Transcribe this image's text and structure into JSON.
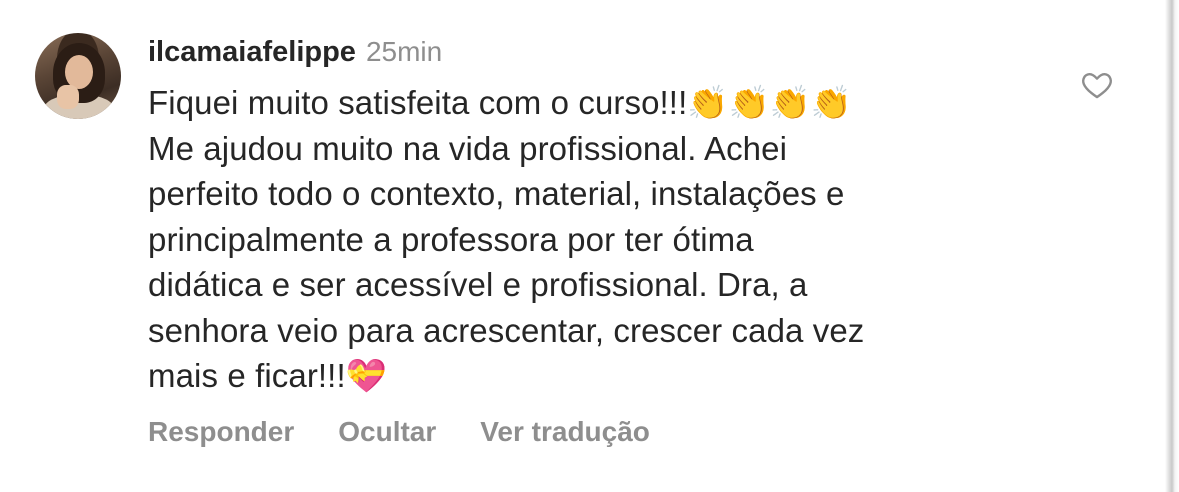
{
  "comment": {
    "username": "ilcamaiafelippe",
    "timestamp": "25min",
    "text": "Fiquei muito satisfeita com o curso!!!👏👏👏👏\nMe ajudou muito na vida profissional. Achei\nperfeito todo o contexto, material, instalações e\nprincipalmente a professora por ter ótima\ndidática e ser acessível e profissional. Dra, a\nsenhora veio para acrescentar, crescer cada vez\nmais e ficar!!!💝",
    "actions": {
      "reply": "Responder",
      "hide": "Ocultar",
      "translate": "Ver tradução"
    },
    "icons": {
      "like": "heart-outline-icon",
      "avatar": "profile-photo"
    },
    "colors": {
      "text": "#262626",
      "muted": "#8e8e8e"
    }
  }
}
